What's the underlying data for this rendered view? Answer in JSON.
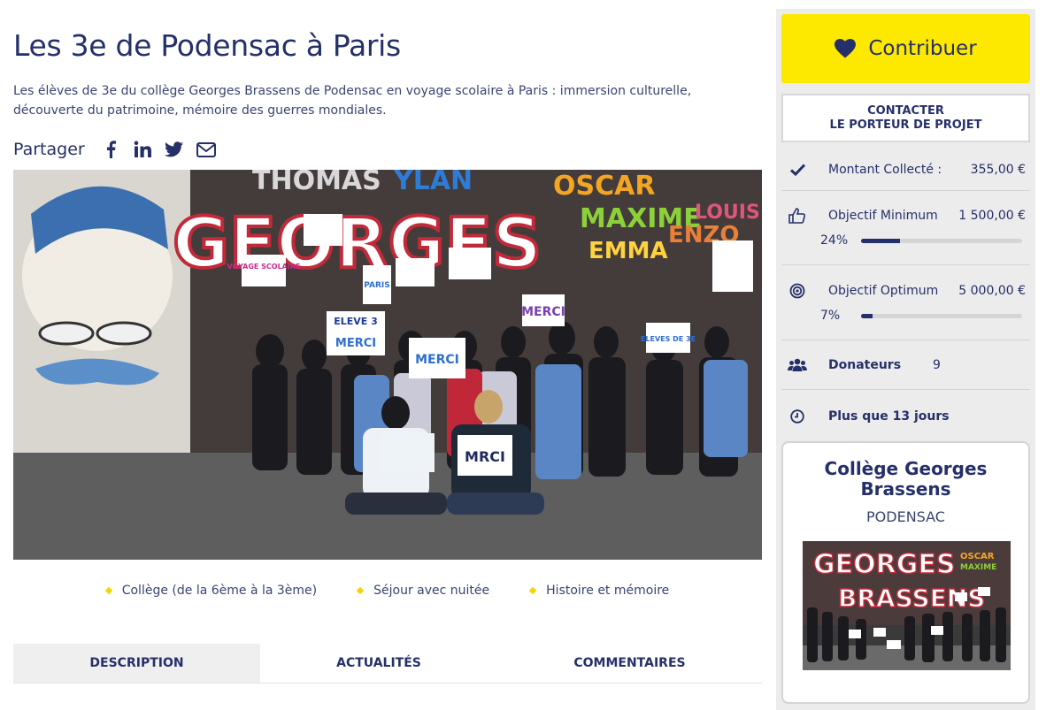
{
  "project": {
    "title": "Les 3e de Podensac à Paris",
    "description": "Les élèves de 3e du collège Georges Brassens de Podensac en voyage scolaire à Paris : immersion culturelle, découverte du patrimoine, mémoire des guerres mondiales."
  },
  "share": {
    "label": "Partager",
    "icons": [
      "facebook-icon",
      "linkedin-icon",
      "twitter-icon",
      "email-icon"
    ]
  },
  "hero_image": {
    "mural_words": [
      "THOMAS",
      "YLAN",
      "OSCAR",
      "MAXIME",
      "EMMA",
      "ENZO",
      "LOUIS",
      "GEORGES"
    ],
    "signs": [
      "VOYAGE SCOLAIRE",
      "PARIS",
      "MERCI",
      "ELEVE 3",
      "MERCI",
      "MERCI",
      "MRCI",
      "ELEVES DE 3E"
    ]
  },
  "tags": [
    "Collège (de la 6ème à la 3ème)",
    "Séjour avec nuitée",
    "Histoire et mémoire"
  ],
  "tabs": [
    "DESCRIPTION",
    "ACTUALITÉS",
    "COMMENTAIRES"
  ],
  "active_tab": "DESCRIPTION",
  "sidebar": {
    "contribute_label": "Contribuer",
    "contact_line1": "CONTACTER",
    "contact_line2": "LE PORTEUR DE PROJET",
    "collected": {
      "label": "Montant Collecté :",
      "value": "355,00 €"
    },
    "min_goal": {
      "label": "Objectif Minimum",
      "value": "1 500,00 €",
      "percent_label": "24%",
      "progress": 0.24
    },
    "opt_goal": {
      "label": "Objectif Optimum",
      "value": "5 000,00 €",
      "percent_label": "7%",
      "progress": 0.07
    },
    "donors": {
      "label": "Donateurs",
      "value": "9"
    },
    "remaining": {
      "label": "Plus que 13 jours"
    },
    "school": {
      "name": "Collège Georges Brassens",
      "city": "PODENSAC",
      "mural_line1": "GEORGES",
      "mural_line2": "BRASSENS"
    }
  },
  "colors": {
    "navy": "#25306a",
    "yellow": "#fde800",
    "diamond": "#f2d600"
  }
}
